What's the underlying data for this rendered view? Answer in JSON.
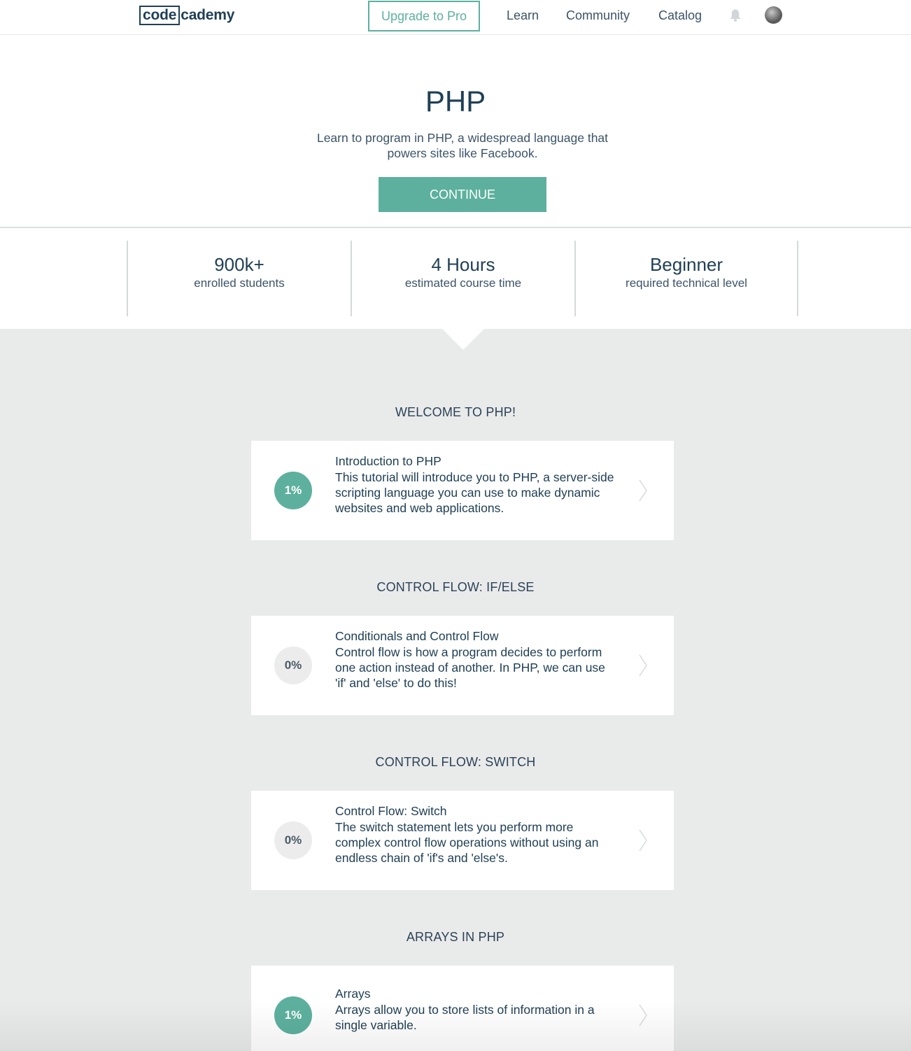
{
  "nav": {
    "logo_box": "code",
    "logo_rest": "cademy",
    "upgrade_label": "Upgrade to Pro",
    "links": [
      "Learn",
      "Community",
      "Catalog"
    ],
    "bell_icon": "bell-icon",
    "avatar_icon": "user-avatar"
  },
  "hero": {
    "title": "PHP",
    "description": "Learn to program in PHP, a widespread language that powers sites like Facebook.",
    "continue_label": "CONTINUE"
  },
  "stats": [
    {
      "value": "900k+",
      "label": "enrolled students"
    },
    {
      "value": "4 Hours",
      "label": "estimated course time"
    },
    {
      "value": "Beginner",
      "label": "required technical level"
    }
  ],
  "sections": [
    {
      "title": "WELCOME TO PHP!",
      "lesson": {
        "progress": "1%",
        "title": "Introduction to PHP",
        "description": "This tutorial will introduce you to PHP, a server-side scripting language you can use to make dynamic websites and web applications."
      }
    },
    {
      "title": "CONTROL FLOW: IF/ELSE",
      "lesson": {
        "progress": "0%",
        "title": "Conditionals and Control Flow",
        "description": "Control flow is how a program decides to perform one action instead of another. In PHP, we can use 'if' and 'else' to do this!"
      }
    },
    {
      "title": "CONTROL FLOW: SWITCH",
      "lesson": {
        "progress": "0%",
        "title": "Control Flow: Switch",
        "description": "The switch statement lets you perform more complex control flow operations without using an endless chain of 'if's and 'else's."
      }
    },
    {
      "title": "ARRAYS IN PHP",
      "lesson": {
        "progress": "1%",
        "title": "Arrays",
        "description": "Arrays allow you to store lists of information in a single variable."
      }
    }
  ],
  "colors": {
    "accent": "#5db09e",
    "text_dark": "#204056",
    "grey_bg": "#e9eaea"
  }
}
